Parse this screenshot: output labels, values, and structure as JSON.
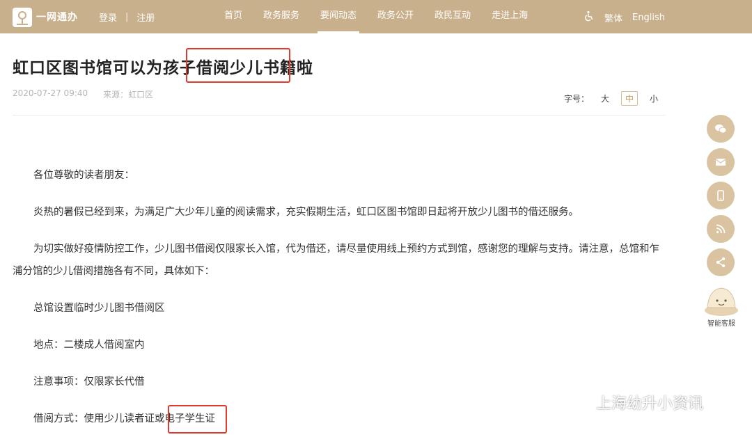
{
  "header": {
    "logo_text": "一网通办",
    "login": "登录",
    "separator": "|",
    "register": "注册",
    "nav": [
      {
        "label": "首页"
      },
      {
        "label": "政务服务"
      },
      {
        "label": "要闻动态",
        "active": true
      },
      {
        "label": "政务公开"
      },
      {
        "label": "政民互动"
      },
      {
        "label": "走进上海"
      }
    ],
    "traditional": "繁体",
    "english": "English"
  },
  "article": {
    "title": "虹口区图书馆可以为孩子借阅少儿书籍啦",
    "date": "2020-07-27 09:40",
    "source": "来源：虹口区",
    "font_label": "字号：",
    "font_large": "大",
    "font_medium": "中",
    "font_small": "小",
    "paragraphs": [
      "各位尊敬的读者朋友：",
      "炎热的暑假已经到来，为满足广大少年儿童的阅读需求，充实假期生活，虹口区图书馆即日起将开放少儿图书的借还服务。",
      "为切实做好疫情防控工作，少儿图书借阅仅限家长入馆，代为借还，请尽量使用线上预约方式到馆，感谢您的理解与支持。请注意，总馆和乍浦分馆的少儿借阅措施各有不同，具体如下：",
      "总馆设置临时少儿图书借阅区",
      "地点：二楼成人借阅室内",
      "注意事项：仅限家长代借",
      "借阅方式：使用少儿读者证或电子学生证"
    ]
  },
  "sidebar": {
    "bot_label": "智能客服"
  },
  "watermark": "上海幼升小资讯",
  "colors": {
    "brand": "#c9b08c",
    "side_button": "#d9c3a1",
    "highlight_box": "#e03a2e"
  }
}
